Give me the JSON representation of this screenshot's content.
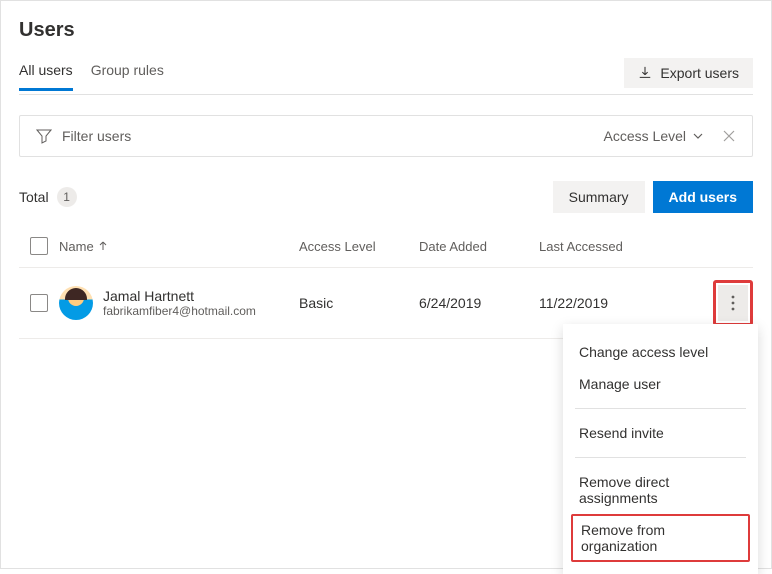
{
  "page_title": "Users",
  "tabs": {
    "all_users": "All users",
    "group_rules": "Group rules"
  },
  "export_label": "Export users",
  "filter": {
    "placeholder": "Filter users",
    "access_level": "Access Level"
  },
  "total": {
    "label": "Total",
    "count": "1"
  },
  "buttons": {
    "summary": "Summary",
    "add_users": "Add users"
  },
  "columns": {
    "name": "Name",
    "access": "Access Level",
    "date_added": "Date Added",
    "last_accessed": "Last Accessed"
  },
  "rows": [
    {
      "name": "Jamal Hartnett",
      "email": "fabrikamfiber4@hotmail.com",
      "access": "Basic",
      "date_added": "6/24/2019",
      "last_accessed": "11/22/2019"
    }
  ],
  "menu": {
    "change_access": "Change access level",
    "manage_user": "Manage user",
    "resend_invite": "Resend invite",
    "remove_direct": "Remove direct assignments",
    "remove_org": "Remove from organization"
  }
}
